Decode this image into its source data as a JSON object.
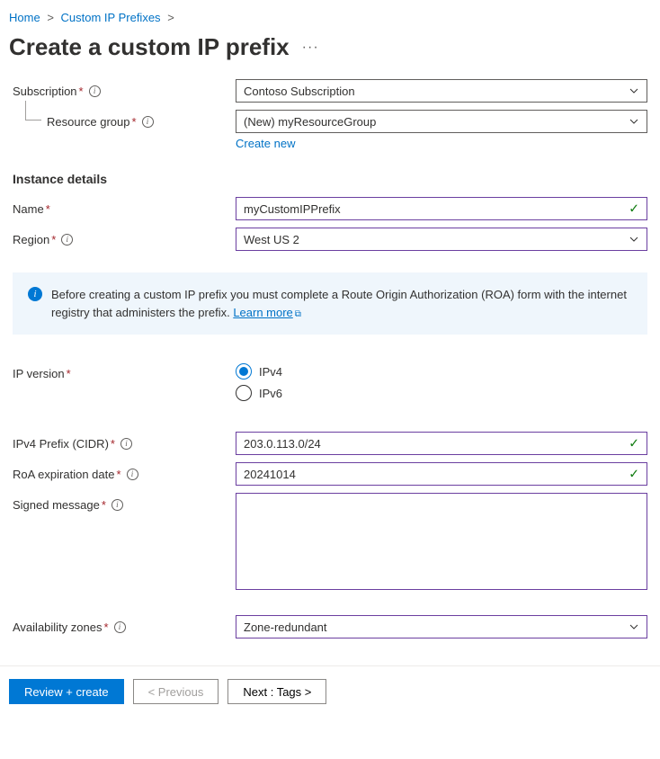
{
  "breadcrumb": {
    "home": "Home",
    "parent": "Custom IP Prefixes"
  },
  "page": {
    "title": "Create a custom IP prefix"
  },
  "labels": {
    "subscription": "Subscription",
    "resource_group": "Resource group",
    "create_new": "Create new",
    "instance_details": "Instance details",
    "name": "Name",
    "region": "Region",
    "ip_version": "IP version",
    "ipv4_prefix": "IPv4 Prefix (CIDR)",
    "roa_expiration": "RoA expiration date",
    "signed_message": "Signed message",
    "availability_zones": "Availability zones"
  },
  "values": {
    "subscription": "Contoso Subscription",
    "resource_group": "(New) myResourceGroup",
    "name": "myCustomIPPrefix",
    "region": "West US 2",
    "ipv4": "IPv4",
    "ipv6": "IPv6",
    "ipv4_prefix": "203.0.113.0/24",
    "roa_expiration": "20241014",
    "signed_message": "",
    "availability_zones": "Zone-redundant"
  },
  "info_box": {
    "text": "Before creating a custom IP prefix you must complete a Route Origin Authorization (ROA) form with the internet registry that administers the prefix. ",
    "link": "Learn more"
  },
  "footer": {
    "review_create": "Review + create",
    "previous": "< Previous",
    "next": "Next : Tags >"
  }
}
